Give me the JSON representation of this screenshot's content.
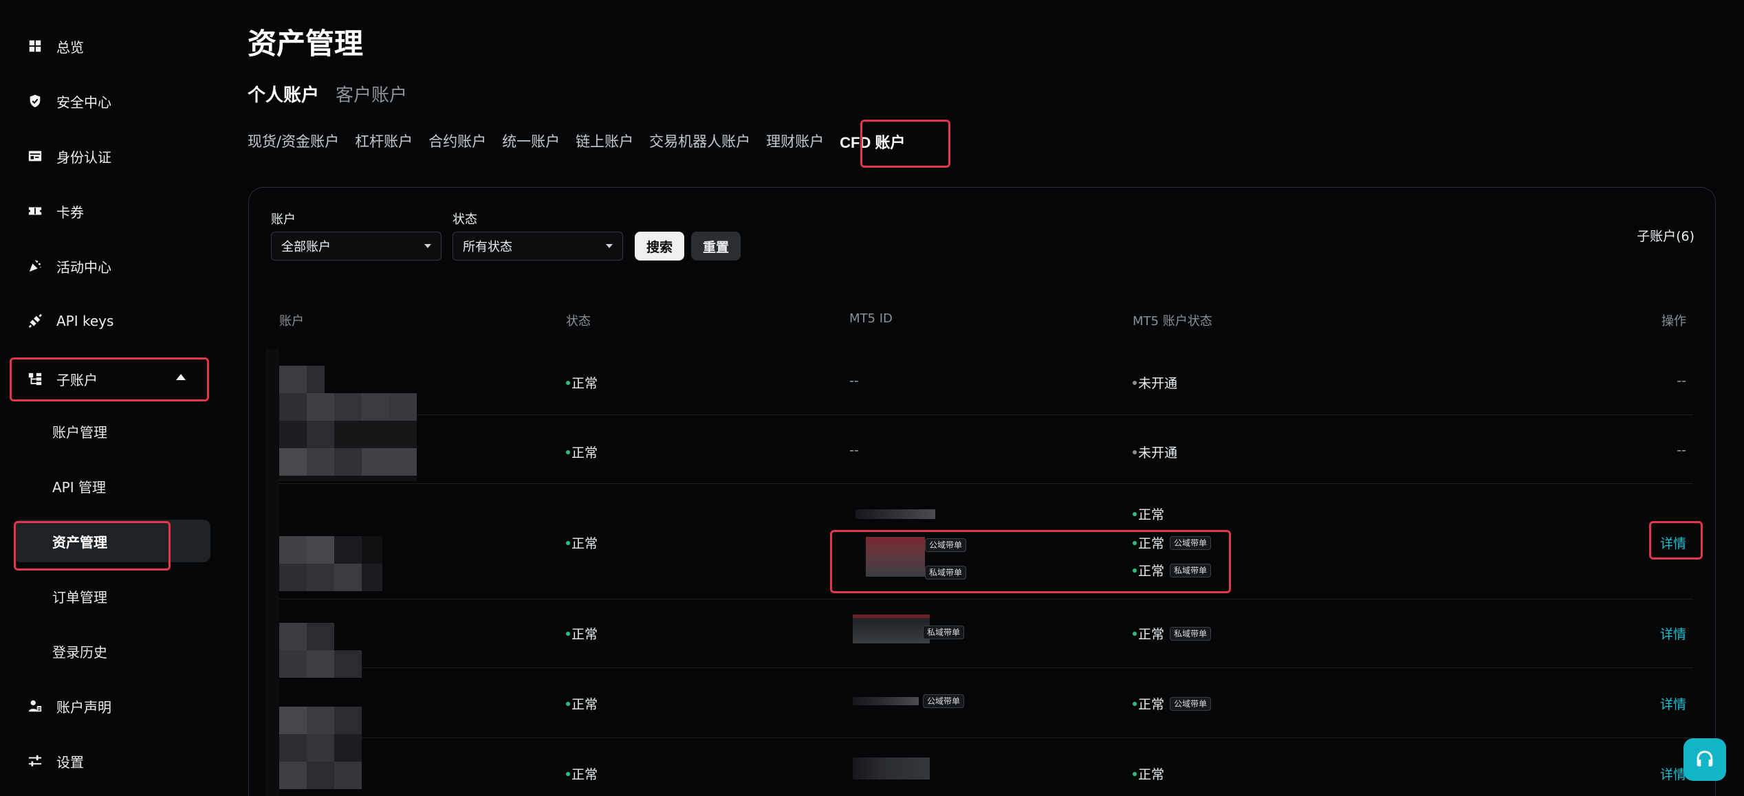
{
  "sidebar": {
    "items": [
      {
        "label": "总览",
        "icon": "grid-icon"
      },
      {
        "label": "安全中心",
        "icon": "shield-icon"
      },
      {
        "label": "身份认证",
        "icon": "id-card-icon"
      },
      {
        "label": "卡券",
        "icon": "ticket-icon"
      },
      {
        "label": "活动中心",
        "icon": "party-icon"
      },
      {
        "label": "API keys",
        "icon": "api-icon"
      },
      {
        "label": "子账户",
        "icon": "sub-account-icon"
      },
      {
        "label": "账户声明",
        "icon": "user-doc-icon"
      },
      {
        "label": "设置",
        "icon": "sliders-icon"
      }
    ],
    "sub_items": [
      "账户管理",
      "API 管理",
      "资产管理",
      "订单管理",
      "登录历史"
    ]
  },
  "page": {
    "title": "资产管理",
    "account_tabs": [
      "个人账户",
      "客户账户"
    ],
    "type_tabs": [
      "现货/资金账户",
      "杠杆账户",
      "合约账户",
      "统一账户",
      "链上账户",
      "交易机器人账户",
      "理财账户",
      "CFD 账户"
    ]
  },
  "filters": {
    "account_label": "账户",
    "account_value": "全部账户",
    "status_label": "状态",
    "status_value": "所有状态",
    "search_label": "搜索",
    "reset_label": "重置",
    "subaccount_count": "子账户(6)"
  },
  "table": {
    "headers": [
      "账户",
      "状态",
      "MT5 ID",
      "MT5 账户状态",
      "操作"
    ],
    "rows": [
      {
        "status": "正常",
        "mt5_id": "--",
        "mt5_status": "未开通",
        "action": "--"
      },
      {
        "status": "正常",
        "mt5_id": "--",
        "mt5_status": "未开通",
        "action": "--"
      },
      {
        "status": "正常",
        "mt5_ids": [
          {
            "tag": ""
          },
          {
            "tag": "公域带单"
          },
          {
            "tag": "私域带单"
          }
        ],
        "mt5_statuses": [
          {
            "text": "正常",
            "tag": ""
          },
          {
            "text": "正常",
            "tag": "公域带单"
          },
          {
            "text": "正常",
            "tag": "私域带单"
          }
        ],
        "action": "详情"
      },
      {
        "status": "正常",
        "mt5_tag": "私域带单",
        "mt5_status": "正常",
        "mt5_status_tag": "私域带单",
        "action": "详情"
      },
      {
        "status": "正常",
        "mt5_tag": "公域带单",
        "mt5_status": "正常",
        "mt5_status_tag": "公域带单",
        "action": "详情"
      },
      {
        "status": "正常",
        "mt5_tag": "",
        "mt5_status": "正常",
        "mt5_status_tag": "",
        "action": "详情"
      }
    ]
  },
  "colors": {
    "accent_cyan": "#18c0d0",
    "status_green": "#2ec27e",
    "highlight_red": "#e5354d",
    "background": "#050607"
  }
}
